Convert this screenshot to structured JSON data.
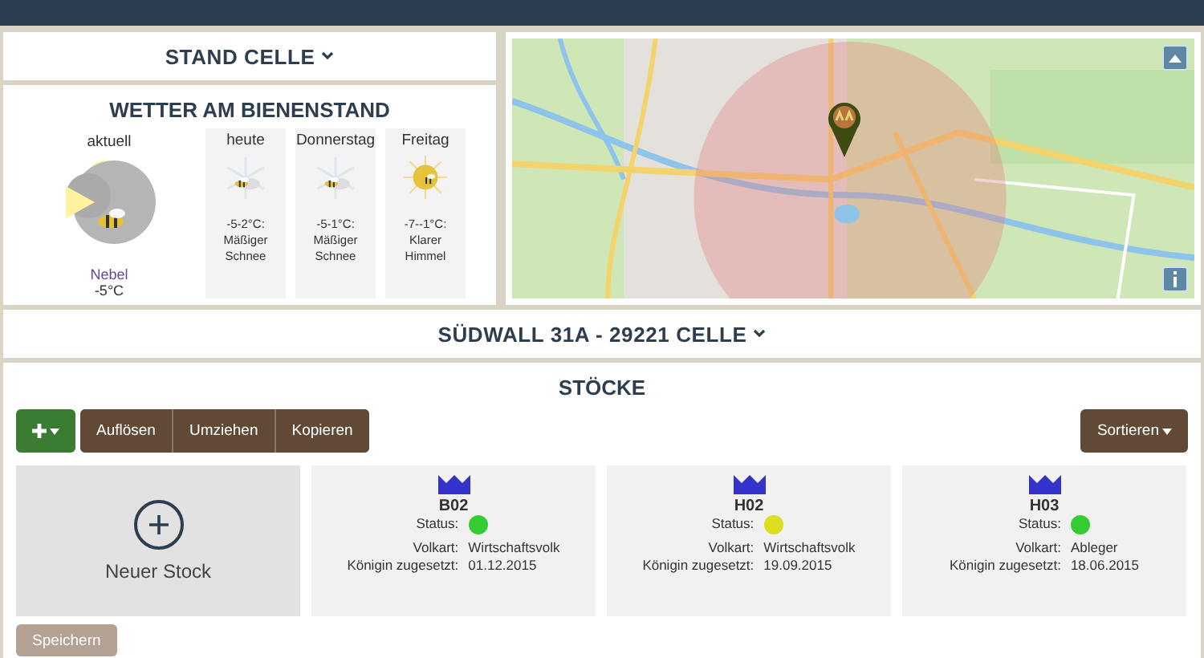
{
  "stand": {
    "title": "STAND CELLE"
  },
  "weather": {
    "title": "WETTER AM BIENENSTAND",
    "current": {
      "label": "aktuell",
      "kind": "fog",
      "condition": "Nebel",
      "temp": "-5°C"
    },
    "days": [
      {
        "label": "heute",
        "kind": "snow",
        "temp": "-5-2°C:",
        "condition": "Mäßiger Schnee"
      },
      {
        "label": "Donnerstag",
        "kind": "snow",
        "temp": "-5-1°C:",
        "condition": "Mäßiger Schnee"
      },
      {
        "label": "Freitag",
        "kind": "sun",
        "temp": "-7--1°C:",
        "condition": "Klarer Himmel"
      }
    ]
  },
  "address": {
    "title": "SÜDWALL 31A - 29221 CELLE"
  },
  "hives": {
    "title": "STÖCKE",
    "actions": [
      "Auflösen",
      "Umziehen",
      "Kopieren"
    ],
    "sort": "Sortieren",
    "new_label": "Neuer Stock",
    "items": [
      {
        "name": "B02",
        "status_label": "Status:",
        "color": "#33cc33",
        "type_label": "Volkart:",
        "type": "Wirtschaftsvolk",
        "queen_label": "Königin zugesetzt:",
        "queen": "01.12.2015"
      },
      {
        "name": "H02",
        "status_label": "Status:",
        "color": "#dddd22",
        "type_label": "Volkart:",
        "type": "Wirtschaftsvolk",
        "queen_label": "Königin zugesetzt:",
        "queen": "19.09.2015"
      },
      {
        "name": "H03",
        "status_label": "Status:",
        "color": "#33cc33",
        "type_label": "Volkart:",
        "type": "Ableger",
        "queen_label": "Königin zugesetzt:",
        "queen": "18.06.2015"
      }
    ]
  },
  "save": {
    "label": "Speichern",
    "disabled": true
  }
}
